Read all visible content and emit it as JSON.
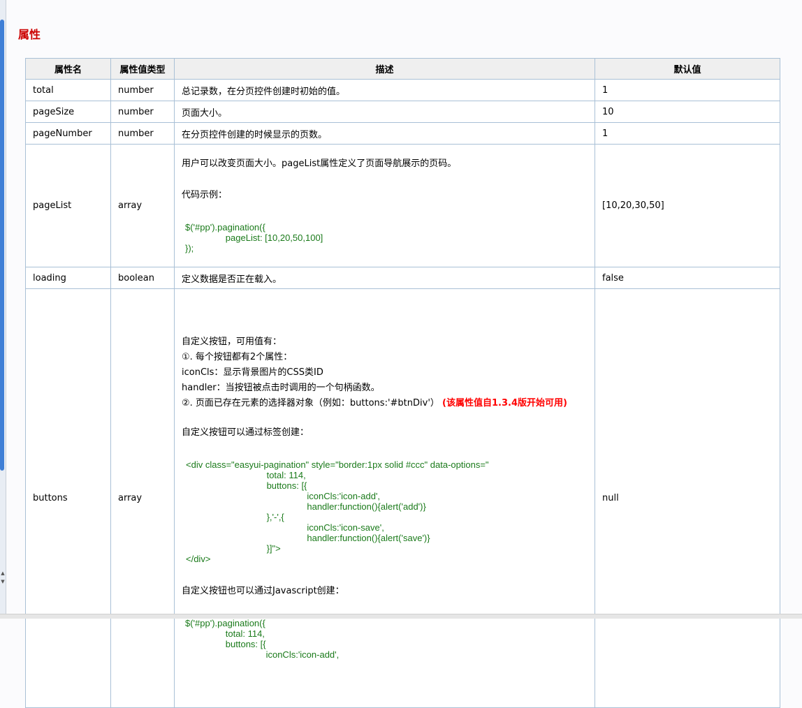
{
  "section_title": "属性",
  "headers": [
    "属性名",
    "属性值类型",
    "描述",
    "默认值"
  ],
  "rows": {
    "total": {
      "name": "total",
      "type": "number",
      "desc": "总记录数，在分页控件创建时初始的值。",
      "default": "1"
    },
    "pageSize": {
      "name": "pageSize",
      "type": "number",
      "desc": "页面大小。",
      "default": "10"
    },
    "pageNumber": {
      "name": "pageNumber",
      "type": "number",
      "desc": "在分页控件创建的时候显示的页数。",
      "default": "1"
    },
    "pageList": {
      "name": "pageList",
      "type": "array",
      "desc_intro": "用户可以改变页面大小。pageList属性定义了页面导航展示的页码。",
      "desc_label": "代码示例：",
      "code": "$('#pp').pagination({\n                pageList: [10,20,50,100]\n});",
      "default": "[10,20,30,50]"
    },
    "loading": {
      "name": "loading",
      "type": "boolean",
      "desc": "定义数据是否正在载入。",
      "default": "false"
    },
    "buttons": {
      "name": "buttons",
      "type": "array",
      "line1": "自定义按钮，可用值有：",
      "line2": "①. 每个按钮都有2个属性：",
      "line3": "iconCls：显示背景图片的CSS类ID",
      "line4": "handler：当按钮被点击时调用的一个句柄函数。",
      "line5": "②. 页面已存在元素的选择器对象（例如：buttons:'#btnDiv'）",
      "line5_note": "(该属性值自1.3.4版开始可用)",
      "tag_label": "自定义按钮可以通过标签创建：",
      "code_tag": "<div class=\"easyui-pagination\" style=\"border:1px solid #ccc\" data-options=\"\n                                total: 114,\n                                buttons: [{\n                                                iconCls:'icon-add',\n                                                handler:function(){alert('add')}\n                                },'-',{\n                                                iconCls:'icon-save',\n                                                handler:function(){alert('save')}\n                                }]\">\n</div>",
      "js_label": "自定义按钮也可以通过Javascript创建：",
      "code_js": "$('#pp').pagination({\n                total: 114,\n                buttons: [{\n                                iconCls:'icon-add',",
      "default": "null"
    }
  }
}
